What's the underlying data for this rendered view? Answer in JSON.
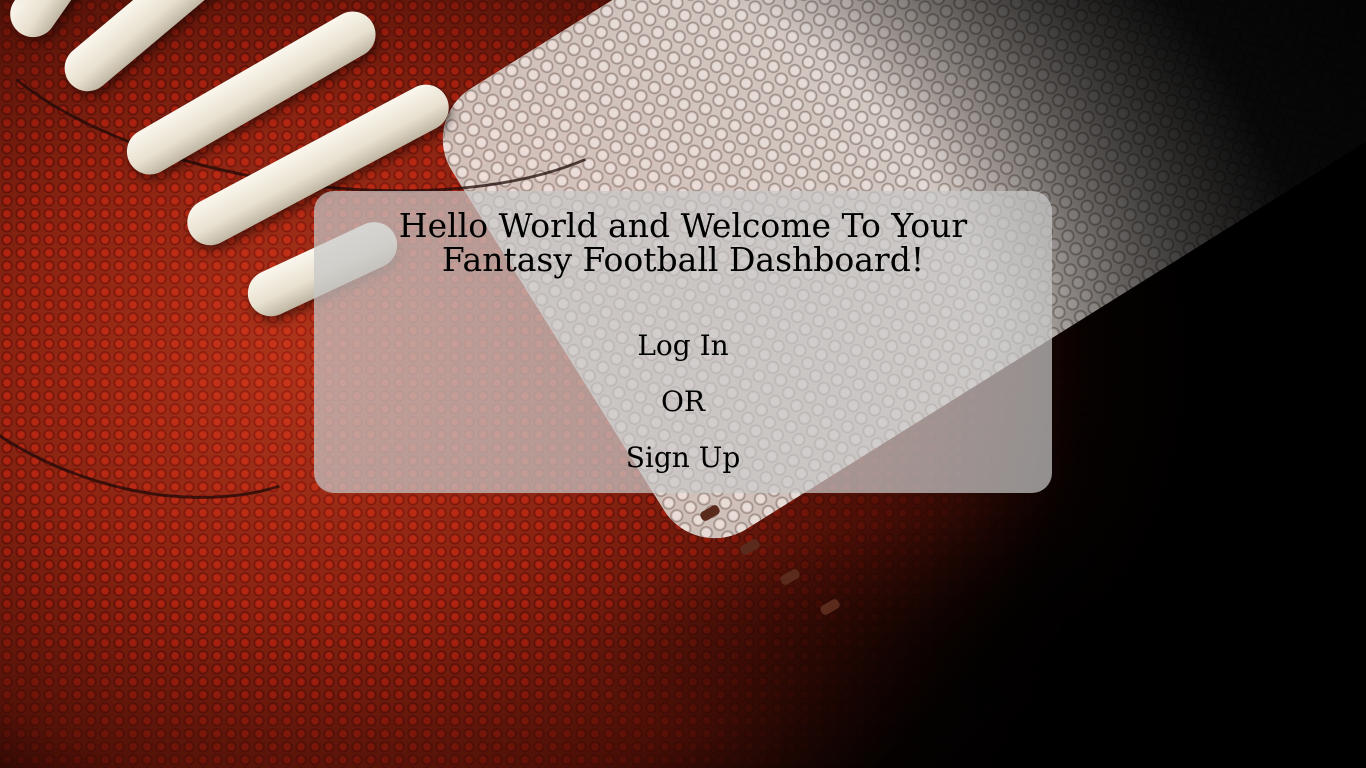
{
  "background": {
    "image": "american-football-closeup",
    "colors": {
      "leather": "#8a2412",
      "stripe": "#efe9e4",
      "lace": "#f3ecdd",
      "vignette": "#000000"
    }
  },
  "card": {
    "title": "Hello World and Welcome To Your Fantasy Football Dashboard!",
    "login_label": "Log In",
    "or_label": "OR",
    "signup_label": "Sign Up",
    "background_color": "#c8c8c8"
  }
}
